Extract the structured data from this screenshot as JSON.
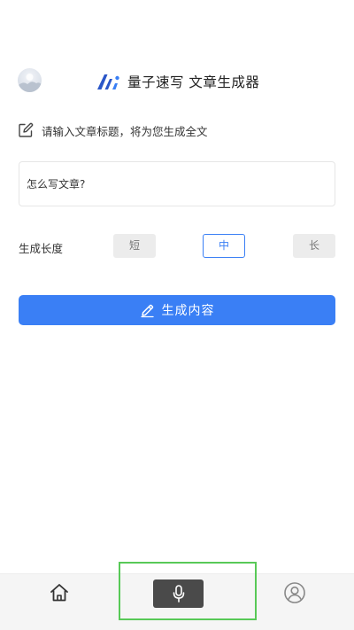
{
  "header": {
    "title": "量子速写 文章生成器",
    "logo_icon": "brand-logo-icon",
    "avatar_icon": "avatar-icon"
  },
  "prompt": {
    "icon": "edit-icon",
    "text": "请输入文章标题，将为您生成全文"
  },
  "input": {
    "value": "怎么写文章?",
    "placeholder": ""
  },
  "length": {
    "label": "生成长度",
    "options": [
      "短",
      "中",
      "长"
    ],
    "selected": "中"
  },
  "generate_button": {
    "label": "生成内容",
    "icon": "pencil-icon"
  },
  "bottom_nav": {
    "items": [
      {
        "icon": "home-icon"
      },
      {
        "icon": "microphone-icon"
      },
      {
        "icon": "user-icon"
      }
    ]
  },
  "colors": {
    "accent": "#3a7ff5",
    "highlight_frame": "#58c957",
    "nav_background": "#f5f5f5",
    "mic_button": "#4a4a4a"
  }
}
